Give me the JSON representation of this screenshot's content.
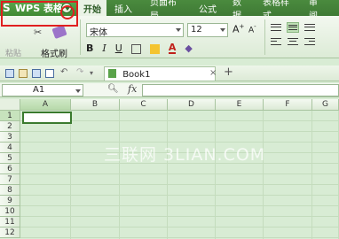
{
  "app": {
    "menu_button_label": "WPS 表格",
    "tabs": [
      {
        "label": "开始",
        "active": true
      },
      {
        "label": "插入"
      },
      {
        "label": "页面布局"
      },
      {
        "label": "公式"
      },
      {
        "label": "数据"
      },
      {
        "label": "表格样式"
      },
      {
        "label": "审阅"
      }
    ]
  },
  "ribbon": {
    "paste_label": "粘贴",
    "format_painter_label": "格式刷",
    "font_name": "宋体",
    "font_size": "12",
    "bold": "B",
    "italic": "I",
    "underline": "U",
    "grow_font": "A",
    "shrink_font": "A"
  },
  "qat": {
    "document_tab": "Book1",
    "close_glyph": "×",
    "add_glyph": "+"
  },
  "formula_bar": {
    "cell_reference": "A1",
    "fx_label": "fx"
  },
  "grid": {
    "columns": [
      "A",
      "B",
      "C",
      "D",
      "E",
      "F",
      "G"
    ],
    "rows": [
      "1",
      "2",
      "3",
      "4",
      "5",
      "6",
      "7",
      "8",
      "9",
      "10",
      "11",
      "12"
    ],
    "active_cell": "A1"
  },
  "watermark": "三联网 3LIAN.COM",
  "colors": {
    "accent": "#3f7a35",
    "highlight": "#e02020",
    "grid_bg": "#d8ecd4"
  }
}
